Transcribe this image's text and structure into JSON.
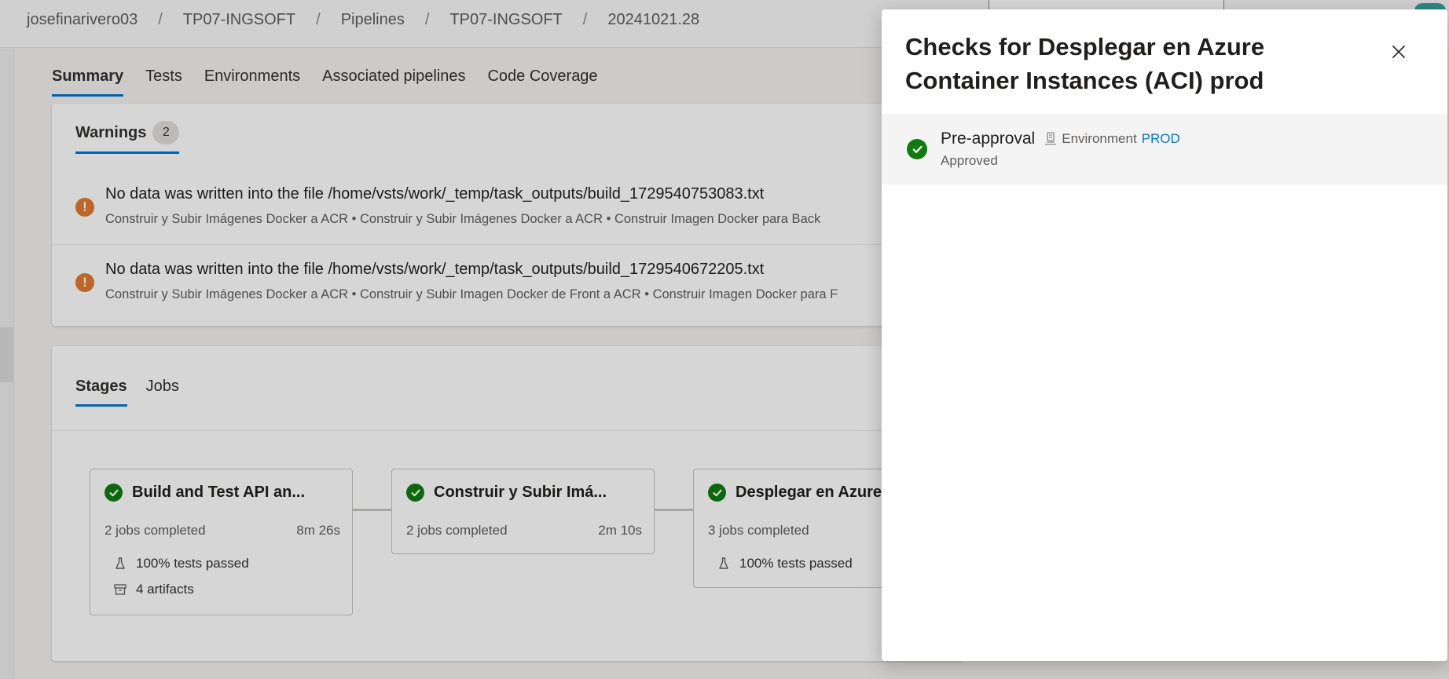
{
  "breadcrumb": {
    "items": [
      "josefinarivero03",
      "TP07-INGSOFT",
      "Pipelines",
      "TP07-INGSOFT",
      "20241021.28"
    ],
    "separator": "/"
  },
  "tabs": [
    {
      "label": "Summary",
      "active": true
    },
    {
      "label": "Tests",
      "active": false
    },
    {
      "label": "Environments",
      "active": false
    },
    {
      "label": "Associated pipelines",
      "active": false
    },
    {
      "label": "Code Coverage",
      "active": false
    }
  ],
  "warnings": {
    "title": "Warnings",
    "count": "2",
    "items": [
      {
        "icon": "warning-icon",
        "message": "No data was written into the file /home/vsts/work/_temp/task_outputs/build_1729540753083.txt",
        "path": "Construir y Subir Imágenes Docker a ACR • Construir y Subir Imágenes Docker a ACR • Construir Imagen Docker para Back"
      },
      {
        "icon": "warning-icon",
        "message": "No data was written into the file /home/vsts/work/_temp/task_outputs/build_1729540672205.txt",
        "path": "Construir y Subir Imágenes Docker a ACR • Construir y Subir Imagen Docker de Front a ACR • Construir Imagen Docker para F"
      }
    ]
  },
  "stages": {
    "tabs": [
      {
        "label": "Stages",
        "active": true
      },
      {
        "label": "Jobs",
        "active": false
      }
    ],
    "items": [
      {
        "name": "Build and Test API an...",
        "jobs": "2 jobs completed",
        "duration": "8m 26s",
        "tests": "100% tests passed",
        "artifacts": "4 artifacts",
        "status": "succeeded"
      },
      {
        "name": "Construir y Subir Imá...",
        "jobs": "2 jobs completed",
        "duration": "2m 10s",
        "status": "succeeded"
      },
      {
        "name": "Desplegar en Azure",
        "jobs": "3 jobs completed",
        "tests": "100% tests passed",
        "status": "succeeded"
      }
    ]
  },
  "panel": {
    "title": "Checks for Desplegar en Azure Container Instances (ACI) prod",
    "close_icon": "close-icon",
    "checks": [
      {
        "name": "Pre-approval",
        "type_label": "Environment",
        "target": "PROD",
        "status": "Approved",
        "icon": "success-check-icon"
      }
    ]
  },
  "colors": {
    "accent": "#0078d4",
    "success": "#107c10",
    "warning": "#e07b2f"
  }
}
